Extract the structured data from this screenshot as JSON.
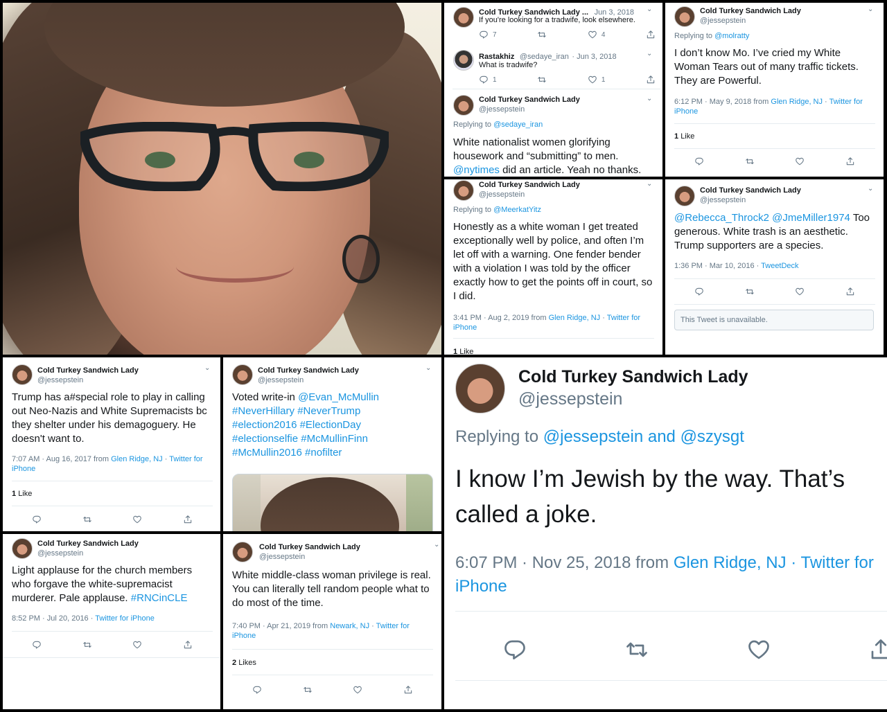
{
  "user": {
    "name": "Cold Turkey Sandwich Lady",
    "handle": "@jessepstein",
    "name_short": "Cold Turkey Sandwich Lady ..."
  },
  "colors": {
    "link": "#1b95e0",
    "secondary": "#657786",
    "text": "#14171a"
  },
  "thread1": {
    "t1": {
      "date": "Jun 3, 2018",
      "text": "If you're looking for a tradwife, look elsewhere.",
      "replies": "7",
      "likes": "4"
    },
    "t2": {
      "name": "Rastakhiz",
      "handle": "@sedaye_iran",
      "date": "Jun 3, 2018",
      "text": "What is tradwife?",
      "replies": "1",
      "likes": "1"
    },
    "t3": {
      "replying_label": "Replying to",
      "replying_to": "@sedaye_iran",
      "text": "White nationalist women glorifying housework and “submitting” to men.",
      "mention": "@nytimes",
      "text_tail": "did an article. Yeah no thanks."
    }
  },
  "tweet_mo": {
    "replying_label": "Replying to",
    "replying_to": "@molratty",
    "text": "I don’t know Mo. I’ve cried my White Woman Tears out of many traffic tickets. They are Powerful.",
    "time": "6:12 PM · May 9, 2018 from",
    "place": "Glen Ridge, NJ",
    "client": "Twitter for iPhone",
    "likes_num": "1",
    "likes_word": "Like"
  },
  "tweet_police": {
    "replying_label": "Replying to",
    "replying_to": "@MeerkatYitz",
    "text": "Honestly as a white woman I get treated exceptionally well by police, and often I’m let off with a warning. One fender bender with a violation I was told by the officer exactly how to get the points off in court, so I did.",
    "time": "3:41 PM · Aug 2, 2019 from",
    "place": "Glen Ridge, NJ",
    "client": "Twitter for iPhone",
    "likes_num": "1",
    "likes_word": "Like"
  },
  "tweet_trash": {
    "mention1": "@Rebecca_Throck2",
    "mention2": "@JmeMiller1974",
    "text": "Too generous. White trash is an aesthetic. Trump supporters are a species.",
    "time": "1:36 PM · Mar 10, 2016 ·",
    "client": "TweetDeck",
    "unavailable": "This Tweet is unavailable."
  },
  "tweet_trump": {
    "text": "Trump has a#special role to play in calling out Neo-Nazis and White Supremacists bc they shelter under his demagoguery. He doesn't want to.",
    "time": "7:07 AM · Aug 16, 2017 from",
    "place": "Glen Ridge, NJ",
    "client": "Twitter for iPhone",
    "likes_num": "1",
    "likes_word": "Like"
  },
  "tweet_vote": {
    "text": "Voted write-in",
    "mention": "@Evan_McMullin",
    "hashtags": "#NeverHillary #NeverTrump #election2016 #ElectionDay #electionselfie #McMullinFinn #McMullin2016 #nofilter"
  },
  "tweet_church": {
    "text": "Light applause for the church members who forgave the white-supremacist murderer. Pale applause.",
    "hashtag": "#RNCinCLE",
    "time": "8:52 PM · Jul 20, 2016 ·",
    "client": "Twitter for iPhone"
  },
  "tweet_privilege": {
    "text": "White middle-class woman privilege is real. You can literally tell random  people what to do most of the time.",
    "time": "7:40 PM · Apr 21, 2019 from",
    "place": "Newark, NJ",
    "client": "Twitter for iPhone",
    "likes_num": "2",
    "likes_word": "Likes"
  },
  "tweet_big": {
    "replying_label": "Replying to",
    "replying_to": "@jessepstein and @szysgt",
    "text": "I know I’m Jewish by the way. That’s called a joke.",
    "time": "6:07 PM · Nov 25, 2018 from",
    "place": "Glen Ridge, NJ",
    "client": "· Twitter for iPhone"
  },
  "icons": [
    "reply-icon",
    "retweet-icon",
    "like-icon",
    "share-icon",
    "chevron-down-icon"
  ]
}
